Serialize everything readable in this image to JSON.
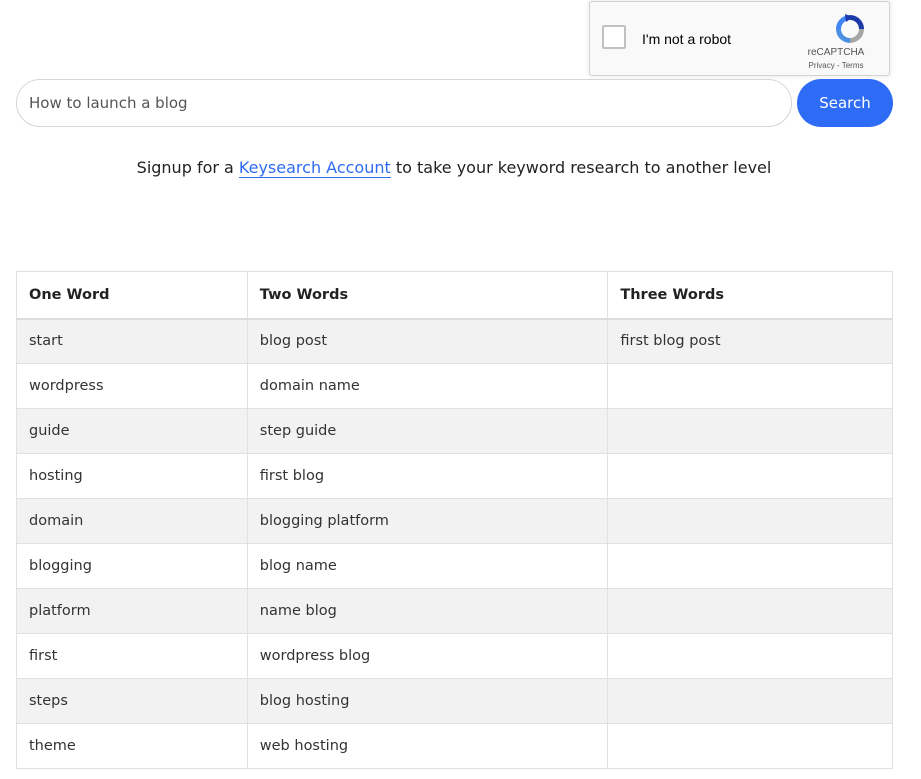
{
  "recaptcha": {
    "label": "I'm not a robot",
    "brand": "reCAPTCHA",
    "privacy": "Privacy",
    "separator": " - ",
    "terms": "Terms",
    "logo_icon": "recaptcha-logo-icon"
  },
  "search": {
    "value": "How to launch a blog",
    "button_label": "Search"
  },
  "promo": {
    "prefix": "Signup for a ",
    "link": "Keysearch Account",
    "suffix": " to take your keyword research to another level"
  },
  "table": {
    "headers": [
      "One Word",
      "Two Words",
      "Three Words"
    ],
    "rows": [
      [
        "start",
        "blog post",
        "first blog post"
      ],
      [
        "wordpress",
        "domain name",
        ""
      ],
      [
        "guide",
        "step guide",
        ""
      ],
      [
        "hosting",
        "first blog",
        ""
      ],
      [
        "domain",
        "blogging platform",
        ""
      ],
      [
        "blogging",
        "blog name",
        ""
      ],
      [
        "platform",
        "name blog",
        ""
      ],
      [
        "first",
        "wordpress blog",
        ""
      ],
      [
        "steps",
        "blog hosting",
        ""
      ],
      [
        "theme",
        "web hosting",
        ""
      ]
    ]
  },
  "colors": {
    "accent": "#2f6cf6",
    "row_stripe": "#f2f2f2",
    "border": "#e1e1e1"
  }
}
